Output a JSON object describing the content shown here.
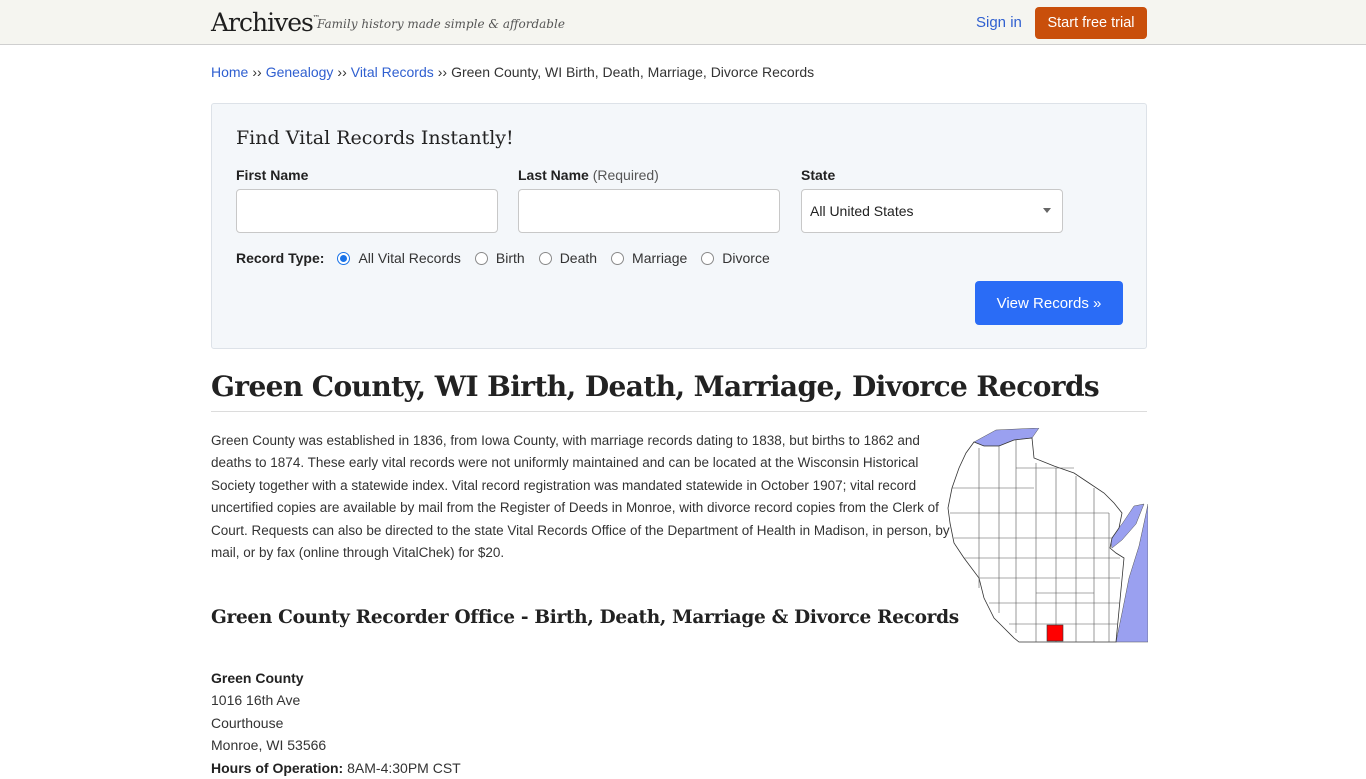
{
  "header": {
    "logo": "Archives",
    "logo_tm": "™",
    "tagline": "Family history made simple & affordable",
    "sign_in": "Sign in",
    "start_trial": "Start free trial"
  },
  "breadcrumb": {
    "items": [
      "Home",
      "Genealogy",
      "Vital Records"
    ],
    "separator": "››",
    "current": "Green County, WI Birth, Death, Marriage, Divorce Records"
  },
  "search": {
    "title": "Find Vital Records Instantly!",
    "first_name_label": "First Name",
    "first_name_value": "",
    "last_name_label": "Last Name",
    "last_name_required": "(Required)",
    "last_name_value": "",
    "state_label": "State",
    "state_selected": "All United States",
    "record_type_label": "Record Type:",
    "record_types": [
      "All Vital Records",
      "Birth",
      "Death",
      "Marriage",
      "Divorce"
    ],
    "record_type_selected": "All Vital Records",
    "submit": "View Records »"
  },
  "main": {
    "title": "Green County, WI Birth, Death, Marriage, Divorce Records",
    "intro": "Green County was established in 1836, from Iowa County, with marriage records dating to 1838, but births to 1862 and deaths to 1874. These early vital records were not uniformly maintained and can be located at the Wisconsin Historical Society together with a statewide index. Vital record registration was mandated statewide in October 1907; vital record uncertified copies are available by mail from the Register of Deeds in Monroe, with divorce record copies from the Clerk of Court. Requests can also be directed to the state Vital Records Office of the Department of Health in Madison, in person, by mail, or by fax (online through VitalChek) for $20.",
    "map_alt": "Wisconsin county map with Green County highlighted",
    "section_title": "Green County Recorder Office - Birth, Death, Marriage & Divorce Records",
    "office": {
      "name": "Green County",
      "address1": "1016 16th Ave",
      "address2": "Courthouse",
      "city_state_zip": "Monroe, WI 53566",
      "hours_label": "Hours of Operation:",
      "hours": "8AM-4:30PM CST"
    }
  },
  "colors": {
    "link": "#2f5fd0",
    "trial_button": "#c94f0b",
    "view_button": "#2a6cf6",
    "map_water": "#9aa0f0",
    "map_highlight": "#ff0000"
  }
}
